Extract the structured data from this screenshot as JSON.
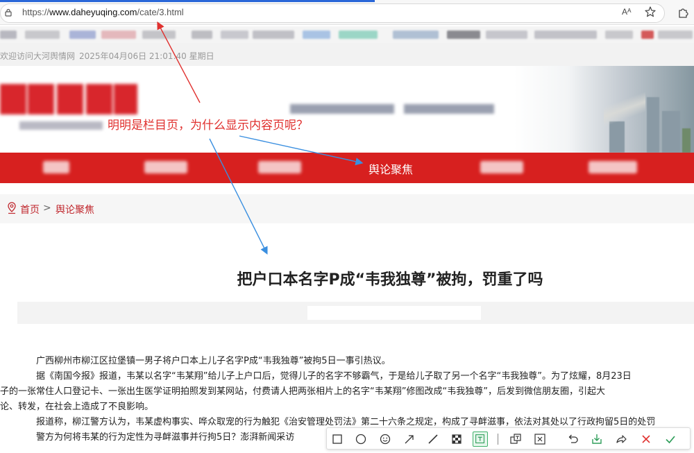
{
  "browser": {
    "url_prefix": "https://",
    "url_domain": "www.daheyuqing.com",
    "url_path": "/cate/3.html",
    "read_aloud_label": "Aᴬ",
    "icons": [
      "lock-icon",
      "read-aloud-icon",
      "favorite-star-icon",
      "extensions-icon"
    ]
  },
  "site": {
    "welcome": "欢迎访问大河舆情网",
    "datetime": "2025年04月06日 21:01:40 星期日"
  },
  "nav": {
    "current": "舆论聚焦"
  },
  "breadcrumb": {
    "home": "首页",
    "separator": ">",
    "current": "舆论聚焦"
  },
  "article": {
    "title": "把户口本名字P成“韦我独尊”被拘，罚重了吗",
    "paragraphs": [
      "广西柳州市柳江区拉堡镇一男子将户口本上儿子名字P成“韦我独尊”被拘5日一事引热议。",
      "据《南国今报》报道，韦某以名字“韦某翔”给儿子上户口后，觉得儿子的名字不够霸气，于是给儿子取了另一个名字“韦我独尊”。为了炫耀，8月23日",
      "子的一张常住人口登记卡、一张出生医学证明拍照发到某网站，付费请人把两张相片上的名字“韦某翔”修图改成“韦我独尊”，后发到微信朋友圈，引起大",
      "论、转发，在社会上造成了不良影响。",
      "报道称，柳江警方认为，韦某虚构事实、哗众取宠的行为触犯《治安管理处罚法》第二十六条之规定，构成了寻衅滋事，依法对其处以了行政拘留5日的处罚",
      "警方为何将韦某的行为定性为寻衅滋事并行拘5日？澎湃新闻采访"
    ]
  },
  "annotation": {
    "question": "明明是栏目页，为什么显示内容页呢？",
    "colors": {
      "red": "#e0302e",
      "blue": "#3a8fe0"
    }
  },
  "toolbar": {
    "tools": [
      "rectangle-tool-icon",
      "ellipse-tool-icon",
      "emoji-tool-icon",
      "arrow-tool-icon",
      "line-tool-icon",
      "mosaic-tool-icon",
      "text-tool-icon",
      "translate-tool-icon",
      "ocr-tool-icon",
      "undo-icon",
      "save-icon",
      "share-icon",
      "cancel-icon",
      "confirm-icon"
    ],
    "active_tool": "text-tool-icon"
  },
  "colors": {
    "brand_red": "#d7201f",
    "crumb_red": "#c0272d"
  }
}
